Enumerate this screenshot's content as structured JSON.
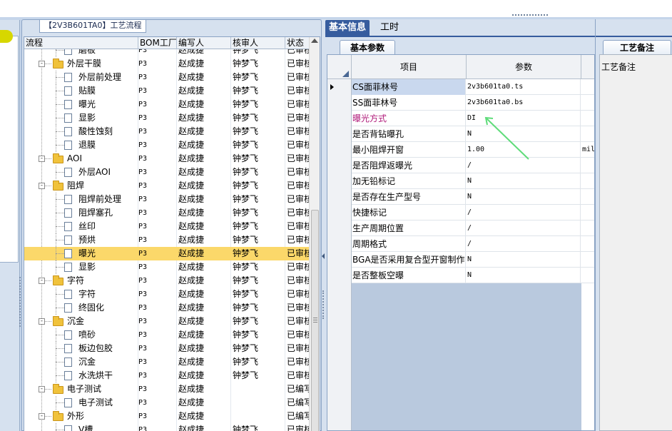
{
  "left_panel": {
    "title": "【2V3B601TA0】工艺流程",
    "columns": [
      "流程",
      "BOM工厂",
      "编写人",
      "核审人",
      "状态"
    ],
    "rows": [
      {
        "name": "磨板",
        "type": "item",
        "bom": "P3",
        "writer": "赵成捷",
        "reviewer": "钟梦飞",
        "status": "已审核"
      },
      {
        "name": "外层干膜",
        "type": "folder",
        "bom": "P3",
        "writer": "赵成捷",
        "reviewer": "钟梦飞",
        "status": "已审核"
      },
      {
        "name": "外层前处理",
        "type": "item",
        "bom": "P3",
        "writer": "赵成捷",
        "reviewer": "钟梦飞",
        "status": "已审核"
      },
      {
        "name": "贴膜",
        "type": "item",
        "bom": "P3",
        "writer": "赵成捷",
        "reviewer": "钟梦飞",
        "status": "已审核"
      },
      {
        "name": "曝光",
        "type": "item",
        "bom": "P3",
        "writer": "赵成捷",
        "reviewer": "钟梦飞",
        "status": "已审核"
      },
      {
        "name": "显影",
        "type": "item",
        "bom": "P3",
        "writer": "赵成捷",
        "reviewer": "钟梦飞",
        "status": "已审核"
      },
      {
        "name": "酸性蚀刻",
        "type": "item",
        "bom": "P3",
        "writer": "赵成捷",
        "reviewer": "钟梦飞",
        "status": "已审核"
      },
      {
        "name": "退膜",
        "type": "item",
        "bom": "P3",
        "writer": "赵成捷",
        "reviewer": "钟梦飞",
        "status": "已审核"
      },
      {
        "name": "AOI",
        "type": "folder",
        "bom": "P3",
        "writer": "赵成捷",
        "reviewer": "钟梦飞",
        "status": "已审核"
      },
      {
        "name": "外层AOI",
        "type": "item",
        "bom": "P3",
        "writer": "赵成捷",
        "reviewer": "钟梦飞",
        "status": "已审核"
      },
      {
        "name": "阻焊",
        "type": "folder",
        "bom": "P3",
        "writer": "赵成捷",
        "reviewer": "钟梦飞",
        "status": "已审核"
      },
      {
        "name": "阻焊前处理",
        "type": "item",
        "bom": "P3",
        "writer": "赵成捷",
        "reviewer": "钟梦飞",
        "status": "已审核"
      },
      {
        "name": "阻焊塞孔",
        "type": "item",
        "bom": "P3",
        "writer": "赵成捷",
        "reviewer": "钟梦飞",
        "status": "已审核"
      },
      {
        "name": "丝印",
        "type": "item",
        "bom": "P3",
        "writer": "赵成捷",
        "reviewer": "钟梦飞",
        "status": "已审核"
      },
      {
        "name": "预烘",
        "type": "item",
        "bom": "P3",
        "writer": "赵成捷",
        "reviewer": "钟梦飞",
        "status": "已审核"
      },
      {
        "name": "曝光",
        "type": "item",
        "selected": true,
        "bom": "P3",
        "writer": "赵成捷",
        "reviewer": "钟梦飞",
        "status": "已审核"
      },
      {
        "name": "显影",
        "type": "item",
        "bom": "P3",
        "writer": "赵成捷",
        "reviewer": "钟梦飞",
        "status": "已审核"
      },
      {
        "name": "字符",
        "type": "folder",
        "bom": "P3",
        "writer": "赵成捷",
        "reviewer": "钟梦飞",
        "status": "已审核"
      },
      {
        "name": "字符",
        "type": "item",
        "bom": "P3",
        "writer": "赵成捷",
        "reviewer": "钟梦飞",
        "status": "已审核"
      },
      {
        "name": "终固化",
        "type": "item",
        "bom": "P3",
        "writer": "赵成捷",
        "reviewer": "钟梦飞",
        "status": "已审核"
      },
      {
        "name": "沉金",
        "type": "folder",
        "bom": "P3",
        "writer": "赵成捷",
        "reviewer": "钟梦飞",
        "status": "已审核"
      },
      {
        "name": "喷砂",
        "type": "item",
        "bom": "P3",
        "writer": "赵成捷",
        "reviewer": "钟梦飞",
        "status": "已审核"
      },
      {
        "name": "板边包胶",
        "type": "item",
        "bom": "P3",
        "writer": "赵成捷",
        "reviewer": "钟梦飞",
        "status": "已审核"
      },
      {
        "name": "沉金",
        "type": "item",
        "bom": "P3",
        "writer": "赵成捷",
        "reviewer": "钟梦飞",
        "status": "已审核"
      },
      {
        "name": "水洗烘干",
        "type": "item",
        "bom": "P3",
        "writer": "赵成捷",
        "reviewer": "钟梦飞",
        "status": "已审核"
      },
      {
        "name": "电子测试",
        "type": "folder",
        "bom": "P3",
        "writer": "赵成捷",
        "reviewer": "",
        "status": "已编写"
      },
      {
        "name": "电子测试",
        "type": "item",
        "bom": "P3",
        "writer": "赵成捷",
        "reviewer": "",
        "status": "已编写"
      },
      {
        "name": "外形",
        "type": "folder",
        "bom": "P3",
        "writer": "赵成捷",
        "reviewer": "",
        "status": "已编写"
      },
      {
        "name": "V槽",
        "type": "item",
        "bom": "P3",
        "writer": "赵成捷",
        "reviewer": "钟梦飞",
        "status": "已审核"
      }
    ]
  },
  "right_panel": {
    "top_tabs": [
      "基本信息",
      "工时"
    ],
    "sub_tab": "基本参数",
    "columns": [
      "项目",
      "参数"
    ],
    "rows": [
      {
        "key": "CS面菲林号",
        "value": "2v3b601ta0.ts",
        "unit": "",
        "current": true,
        "key_highlight": true
      },
      {
        "key": "SS面菲林号",
        "value": "2v3b601ta0.bs",
        "unit": ""
      },
      {
        "key": "曝光方式",
        "value": "DI",
        "unit": "",
        "key_red": true
      },
      {
        "key": "是否背钻曝孔",
        "value": "N",
        "unit": ""
      },
      {
        "key": "最小阻焊开窗",
        "value": "1.00",
        "unit": "mil"
      },
      {
        "key": "是否阻焊返曝光",
        "value": "/",
        "unit": ""
      },
      {
        "key": "加无铅标记",
        "value": "N",
        "unit": ""
      },
      {
        "key": "是否存在生产型号",
        "value": "N",
        "unit": ""
      },
      {
        "key": "快捷标记",
        "value": "/",
        "unit": ""
      },
      {
        "key": "生产周期位置",
        "value": "/",
        "unit": ""
      },
      {
        "key": "周期格式",
        "value": "/",
        "unit": ""
      },
      {
        "key": "BGA是否采用复合型开窗制作",
        "value": "N",
        "unit": ""
      },
      {
        "key": "是否整板空曝",
        "value": "N",
        "unit": ""
      }
    ]
  },
  "notes_panel": {
    "tab": "工艺备注",
    "label": "工艺备注"
  },
  "colors": {
    "selected_row": "#fbd86a",
    "active_tab": "#365c9e",
    "highlight_key": "#c9d8ee",
    "red_key": "#b01a7a",
    "annotation_arrow": "#5fdc7a"
  }
}
